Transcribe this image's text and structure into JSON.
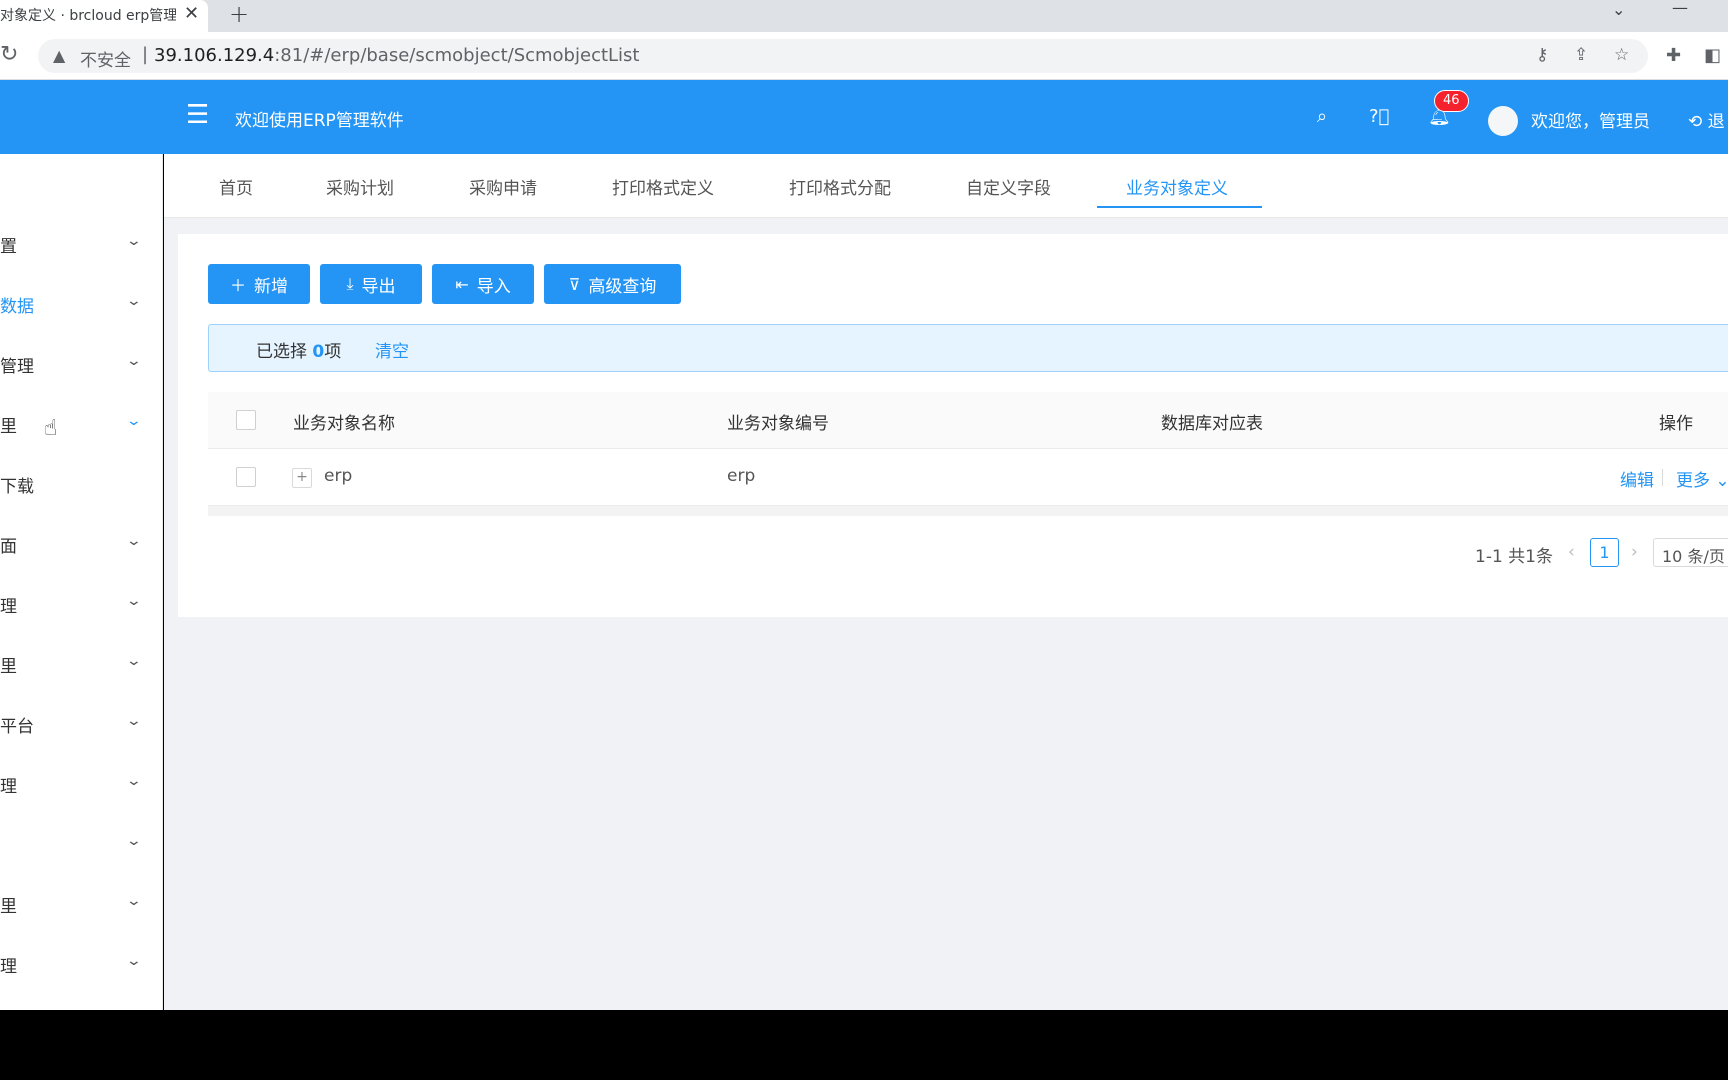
{
  "browser": {
    "tab_title": "对象定义 · brcloud erp管理",
    "tab_close": "✕",
    "new_tab": "+",
    "insecure_label": "不安全",
    "url_host": "39.106.129.4",
    "url_rest": ":81/#/erp/base/scmobject/ScmobjectList"
  },
  "header": {
    "title": "欢迎使用ERP管理软件",
    "notification_count": "46",
    "greeting": "欢迎您，管理员",
    "logout": "退"
  },
  "sidebar": {
    "items": [
      {
        "label": "置",
        "expandable": true
      },
      {
        "label": "数据",
        "expandable": true,
        "active": true
      },
      {
        "label": "管理",
        "expandable": true
      },
      {
        "label": "里",
        "expandable": true,
        "active_chevron": true
      },
      {
        "label": "下载",
        "expandable": false
      },
      {
        "label": "面",
        "expandable": true
      },
      {
        "label": "理",
        "expandable": true
      },
      {
        "label": "里",
        "expandable": true
      },
      {
        "label": "平台",
        "expandable": true
      },
      {
        "label": "理",
        "expandable": true
      },
      {
        "label": "",
        "expandable": true
      },
      {
        "label": "里",
        "expandable": true
      },
      {
        "label": "理",
        "expandable": true
      }
    ]
  },
  "nav_tabs": [
    {
      "label": "首页"
    },
    {
      "label": "采购计划"
    },
    {
      "label": "采购申请"
    },
    {
      "label": "打印格式定义"
    },
    {
      "label": "打印格式分配"
    },
    {
      "label": "自定义字段"
    },
    {
      "label": "业务对象定义",
      "active": true
    }
  ],
  "toolbar": {
    "add_label": "新增",
    "export_label": "导出",
    "import_label": "导入",
    "advanced_query_label": "高级查询"
  },
  "selection": {
    "prefix": "已选择 ",
    "count": "0",
    "suffix": "项",
    "clear_label": "清空"
  },
  "table": {
    "columns": [
      "业务对象名称",
      "业务对象编号",
      "数据库对应表",
      "操作"
    ],
    "rows": [
      {
        "name": "erp",
        "code": "erp",
        "db_table": "",
        "edit": "编辑",
        "more": "更多"
      }
    ]
  },
  "pagination": {
    "total_text": "1-1 共1条",
    "current_page": "1",
    "page_size": "10 条/页"
  },
  "colors": {
    "primary": "#2495f5",
    "badge": "#f5222d",
    "alert_bg": "#e6f4ff"
  }
}
